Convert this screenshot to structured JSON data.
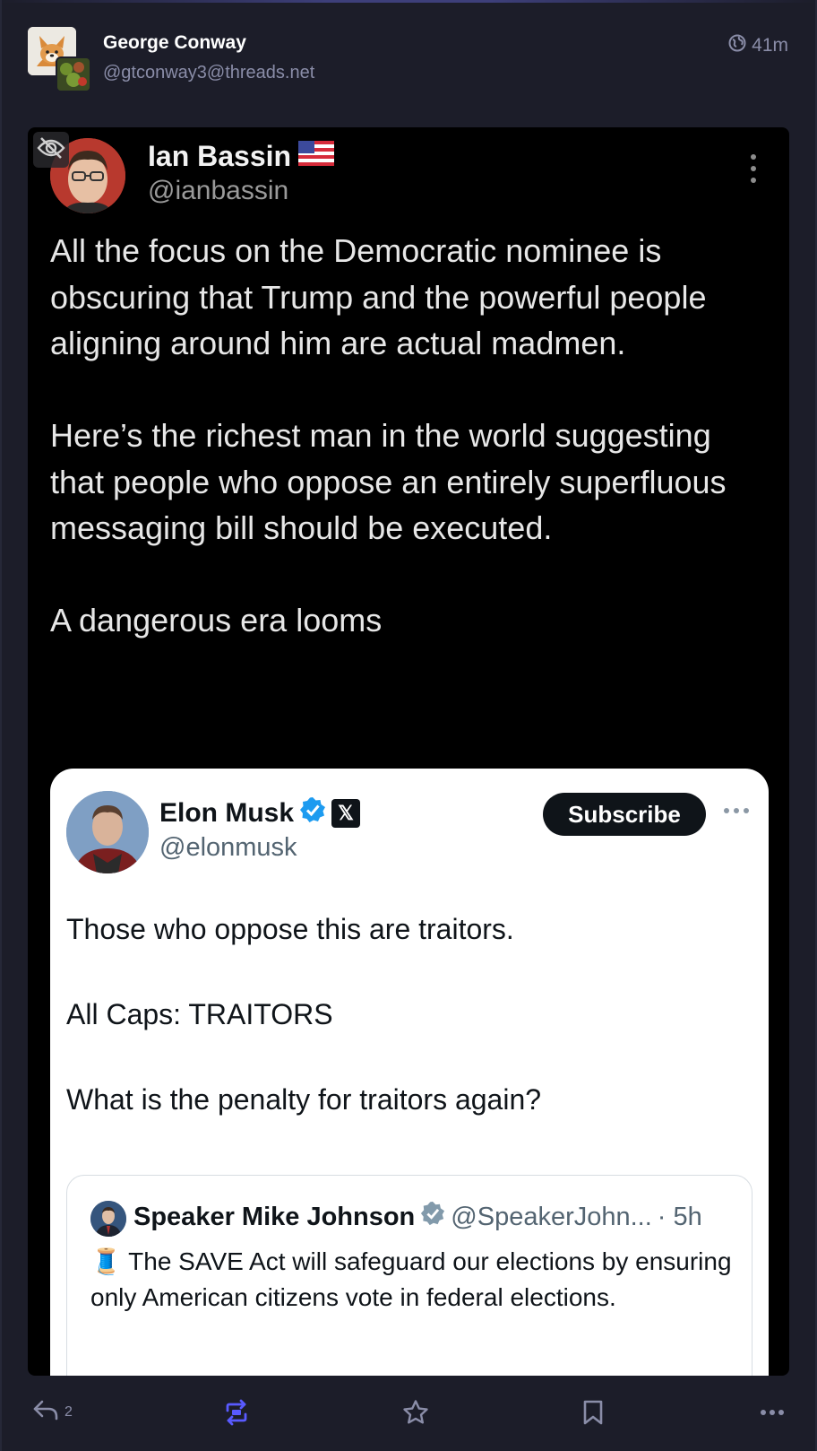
{
  "post": {
    "author_name": "George Conway",
    "author_handle": "@gtconway3@threads.net",
    "time": "41m",
    "visibility_icon": "globe-icon"
  },
  "media": {
    "hide_icon": "eye-slash-icon",
    "tweet": {
      "author_name": "Ian Bassin",
      "flag": "🇺🇸",
      "author_handle": "@ianbassin",
      "paragraphs": [
        "All the focus on the Democratic nominee is obscuring that Trump and the powerful people aligning around him are actual madmen.",
        "Here’s the richest man in the world suggesting that people who oppose an entirely superfluous messaging bill should be executed.",
        "A dangerous era looms"
      ]
    },
    "embedded": {
      "author_name": "Elon Musk",
      "author_handle": "@elonmusk",
      "verified_badge": "verified-badge-icon",
      "x_badge": "𝕏",
      "subscribe_label": "Subscribe",
      "paragraphs": [
        "Those who oppose this are traitors.",
        "All Caps: TRAITORS",
        "What is the penalty for traitors again?"
      ],
      "quote": {
        "author_name": "Speaker Mike Johnson",
        "author_handle": "@SpeakerJohn...",
        "time": "· 5h",
        "emoji": "🧵",
        "text": "The SAVE Act will safeguard our elections by ensuring only American citizens vote in federal elections."
      }
    }
  },
  "actions": {
    "reply_count": "2",
    "reply_icon": "reply-icon",
    "boost_icon": "boost-icon",
    "favourite_icon": "star-icon",
    "bookmark_icon": "bookmark-icon",
    "more_icon": "more-icon"
  },
  "colors": {
    "background": "#1c1d29",
    "muted": "#8a8da8",
    "boost_active": "#595aff",
    "x_blue": "#1d9bf0"
  }
}
